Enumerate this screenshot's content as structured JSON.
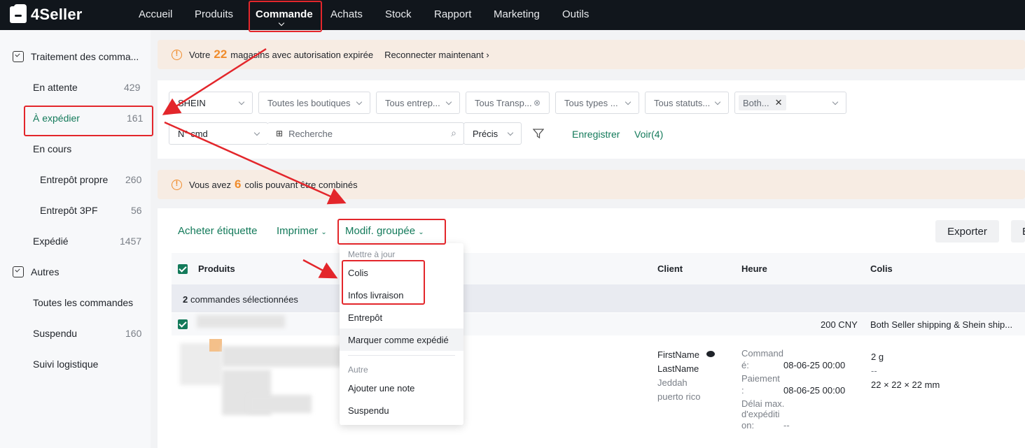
{
  "app": {
    "logo": "4Seller"
  },
  "nav": {
    "items": [
      "Accueil",
      "Produits",
      "Commande",
      "Achats",
      "Stock",
      "Rapport",
      "Marketing",
      "Outils"
    ],
    "active": "Commande"
  },
  "sidebar": {
    "group1": "Traitement des comma...",
    "items": [
      {
        "label": "En attente",
        "count": "429"
      },
      {
        "label": "À expédier",
        "count": "161"
      },
      {
        "label": "En cours",
        "count": ""
      },
      {
        "label": "Entrepôt propre",
        "count": "260"
      },
      {
        "label": "Entrepôt 3PF",
        "count": "56"
      },
      {
        "label": "Expédié",
        "count": "1457"
      }
    ],
    "group2": "Autres",
    "others": [
      {
        "label": "Toutes les commandes",
        "count": ""
      },
      {
        "label": "Suspendu",
        "count": "160"
      },
      {
        "label": "Suivi logistique",
        "count": ""
      }
    ]
  },
  "banner1": {
    "pre": "Votre",
    "num": "22",
    "post": "magasins avec autorisation expirée",
    "link": "Reconnecter maintenant"
  },
  "filters": {
    "platform": "SHEIN",
    "shops": "Toutes les boutiques",
    "warehouse": "Tous entrep...",
    "transport": "Tous Transp...",
    "types": "Tous types ...",
    "status": "Tous statuts...",
    "tag": "Both...",
    "search_field": "N° cmd",
    "search_placeholder": "Recherche",
    "precision": "Précis",
    "save": "Enregistrer",
    "view": "Voir(4)"
  },
  "banner2": {
    "pre": "Vous avez",
    "num": "6",
    "post": "colis pouvant être combinés"
  },
  "toolbar": {
    "buy_label": "Acheter étiquette",
    "print": "Imprimer",
    "bulk": "Modif. groupée",
    "export": "Exporter",
    "partial": "E"
  },
  "table": {
    "headers": {
      "products": "Produits",
      "client": "Client",
      "time": "Heure",
      "parcels": "Colis"
    },
    "selected": {
      "count": "2",
      "text": "commandes sélectionnées"
    },
    "row": {
      "amount": "200 CNY",
      "shipping": "Both Seller shipping & Shein ship...",
      "client": {
        "first": "FirstName",
        "last": "LastName",
        "city": "Jeddah",
        "region": "puerto rico"
      },
      "time": {
        "order_label_1": "Command",
        "order_label_2": "é:",
        "order_value": "08-06-25 00:00",
        "pay_label_1": "Paiement",
        "pay_label_2": ":",
        "pay_value": "08-06-25 00:00",
        "delay_label_1": "Délai max.",
        "delay_label_2": "d'expéditi",
        "delay_label_3": "on:",
        "delay_value": "--"
      },
      "parcel": {
        "weight": "2 g",
        "dash": "--",
        "dims": "22 × 22 × 22 mm"
      }
    }
  },
  "menu": {
    "section1": "Mettre à jour",
    "items1": [
      "Colis",
      "Infos livraison",
      "Entrepôt",
      "Marquer comme expédié"
    ],
    "section2": "Autre",
    "items2": [
      "Ajouter une note",
      "Suspendu"
    ]
  },
  "colors": {
    "brand": "#137a5a",
    "nav_bg": "#11161c",
    "warning": "#f08c2c",
    "annotation": "#e3262b"
  }
}
